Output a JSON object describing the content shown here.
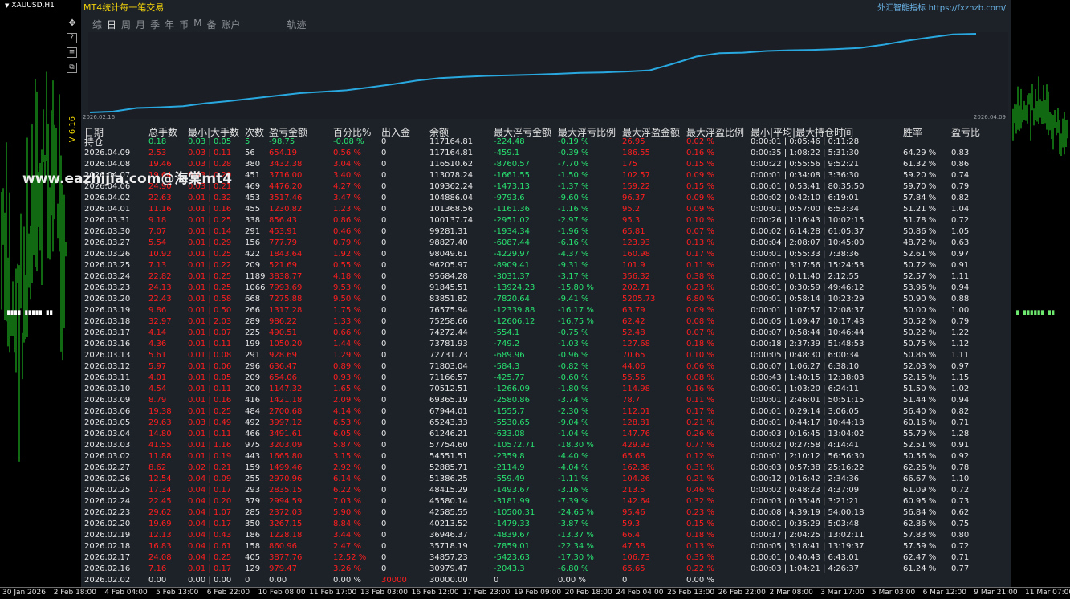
{
  "symbol": "XAUUSD,H1",
  "indicator_label": "V 6.16",
  "dots_left": "∎∎∎∎ ∎∎∎∎∎ ∎∎",
  "dots_right": "∎ ∎∎∎∎∎∎ ∎∎",
  "panel": {
    "title": "MT4统计每一笔交易",
    "brand": "外汇智能指标",
    "url": "https://fxznzb.com/",
    "tabs": [
      "综",
      "日",
      "周",
      "月",
      "季",
      "年",
      "币",
      "M",
      "备",
      "账户",
      "轨迹"
    ],
    "active_tab": "日",
    "equity_start_date": "2026.02.16",
    "equity_end_date": "2026.04.09",
    "equity_color": "#29a8e0",
    "headers": [
      "日期",
      "总手数",
      "最小|大手数",
      "次数",
      "盈亏金额",
      "百分比%",
      "出入金",
      "余额",
      "最大浮亏金额",
      "最大浮亏比例",
      "最大浮盈金额",
      "最大浮盈比例",
      "最小|平均|最大持仓时间",
      "胜率",
      "盈亏比"
    ],
    "holding_row": [
      "持仓",
      "0.18",
      "0.03 | 0.05",
      "5",
      "-98.75",
      "-0.08 %",
      "0",
      "117164.81",
      "-224.48",
      "-0.19 %",
      "26.95",
      "0.02 %",
      "0:00:01 | 0:05:46 | 0:11:28",
      "",
      ""
    ],
    "rows": [
      [
        "2026.04.09",
        "2.53",
        "0.03 | 0.11",
        "56",
        "654.19",
        "0.56 %",
        "0",
        "117164.81",
        "-459.1",
        "-0.39 %",
        "186.55",
        "0.16 %",
        "0:00:35 | 1:08:22 | 5:31:30",
        "64.29 %",
        "0.83"
      ],
      [
        "2026.04.08",
        "19.46",
        "0.03 | 0.28",
        "380",
        "3432.38",
        "3.04 %",
        "0",
        "116510.62",
        "-8760.57",
        "-7.70 %",
        "175",
        "0.15 %",
        "0:00:22 | 0:55:56 | 9:52:21",
        "61.32 %",
        "0.86"
      ],
      [
        "2026.04.07",
        "19.64",
        "0.03 | 0.20",
        "451",
        "3716.00",
        "3.40 %",
        "0",
        "113078.24",
        "-1661.55",
        "-1.50 %",
        "102.57",
        "0.09 %",
        "0:00:01 | 0:34:08 | 3:36:30",
        "59.20 %",
        "0.74"
      ],
      [
        "2026.04.06",
        "24.90",
        "0.03 | 0.21",
        "469",
        "4476.20",
        "4.27 %",
        "0",
        "109362.24",
        "-1473.13",
        "-1.37 %",
        "159.22",
        "0.15 %",
        "0:00:01 | 0:53:41 | 80:35:50",
        "59.70 %",
        "0.79"
      ],
      [
        "2026.04.02",
        "22.63",
        "0.01 | 0.32",
        "453",
        "3517.46",
        "3.47 %",
        "0",
        "104886.04",
        "-9793.6",
        "-9.60 %",
        "96.37",
        "0.09 %",
        "0:00:02 | 0:42:10 | 6:19:01",
        "57.84 %",
        "0.82"
      ],
      [
        "2026.04.01",
        "11.16",
        "0.01 | 0.16",
        "455",
        "1230.82",
        "1.23 %",
        "0",
        "101368.56",
        "-1161.36",
        "-1.16 %",
        "95.2",
        "0.09 %",
        "0:00:01 | 0:57:00 | 6:53:34",
        "51.21 %",
        "1.04"
      ],
      [
        "2026.03.31",
        "9.18",
        "0.01 | 0.25",
        "338",
        "856.43",
        "0.86 %",
        "0",
        "100137.74",
        "-2951.02",
        "-2.97 %",
        "95.3",
        "0.10 %",
        "0:00:26 | 1:16:43 | 10:02:15",
        "51.78 %",
        "0.72"
      ],
      [
        "2026.03.30",
        "7.07",
        "0.01 | 0.14",
        "291",
        "453.91",
        "0.46 %",
        "0",
        "99281.31",
        "-1934.34",
        "-1.96 %",
        "65.81",
        "0.07 %",
        "0:00:02 | 6:14:28 | 61:05:37",
        "50.86 %",
        "1.05"
      ],
      [
        "2026.03.27",
        "5.54",
        "0.01 | 0.29",
        "156",
        "777.79",
        "0.79 %",
        "0",
        "98827.40",
        "-6087.44",
        "-6.16 %",
        "123.93",
        "0.13 %",
        "0:00:04 | 2:08:07 | 10:45:00",
        "48.72 %",
        "0.63"
      ],
      [
        "2026.03.26",
        "10.92",
        "0.01 | 0.25",
        "422",
        "1843.64",
        "1.92 %",
        "0",
        "98049.61",
        "-4229.97",
        "-4.37 %",
        "160.98",
        "0.17 %",
        "0:00:01 | 0:55:33 | 7:38:36",
        "52.61 %",
        "0.97"
      ],
      [
        "2026.03.25",
        "7.13",
        "0.01 | 0.22",
        "209",
        "521.69",
        "0.55 %",
        "0",
        "96205.97",
        "-8909.41",
        "-9.31 %",
        "101.9",
        "0.11 %",
        "0:00:01 | 3:17:56 | 15:24:53",
        "50.72 %",
        "0.91"
      ],
      [
        "2026.03.24",
        "22.82",
        "0.01 | 0.25",
        "1189",
        "3838.77",
        "4.18 %",
        "0",
        "95684.28",
        "-3031.37",
        "-3.17 %",
        "356.32",
        "0.38 %",
        "0:00:01 | 0:11:40 | 2:12:55",
        "52.57 %",
        "1.11"
      ],
      [
        "2026.03.23",
        "24.13",
        "0.01 | 0.25",
        "1066",
        "7993.69",
        "9.53 %",
        "0",
        "91845.51",
        "-13924.23",
        "-15.80 %",
        "202.71",
        "0.23 %",
        "0:00:01 | 0:30:59 | 49:46:12",
        "53.96 %",
        "0.94"
      ],
      [
        "2026.03.20",
        "22.43",
        "0.01 | 0.58",
        "668",
        "7275.88",
        "9.50 %",
        "0",
        "83851.82",
        "-7820.64",
        "-9.41 %",
        "5205.73",
        "6.80 %",
        "0:00:01 | 0:58:14 | 10:23:29",
        "50.90 %",
        "0.88"
      ],
      [
        "2026.03.19",
        "9.86",
        "0.01 | 0.50",
        "266",
        "1317.28",
        "1.75 %",
        "0",
        "76575.94",
        "-12339.88",
        "-16.17 %",
        "63.79",
        "0.09 %",
        "0:00:01 | 1:07:57 | 12:08:37",
        "50.00 %",
        "1.00"
      ],
      [
        "2026.03.18",
        "32.97",
        "0.01 | 2.03",
        "289",
        "986.22",
        "1.33 %",
        "0",
        "75258.66",
        "-12606.12",
        "-16.75 %",
        "62.42",
        "0.08 %",
        "0:00:05 | 1:09:47 | 10:17:48",
        "50.52 %",
        "0.79"
      ],
      [
        "2026.03.17",
        "4.14",
        "0.01 | 0.07",
        "225",
        "490.51",
        "0.66 %",
        "0",
        "74272.44",
        "-554.1",
        "-0.75 %",
        "52.48",
        "0.07 %",
        "0:00:07 | 0:58:44 | 10:46:44",
        "50.22 %",
        "1.22"
      ],
      [
        "2026.03.16",
        "4.36",
        "0.01 | 0.11",
        "199",
        "1050.20",
        "1.44 %",
        "0",
        "73781.93",
        "-749.2",
        "-1.03 %",
        "127.68",
        "0.18 %",
        "0:00:18 | 2:37:39 | 51:48:53",
        "50.75 %",
        "1.12"
      ],
      [
        "2026.03.13",
        "5.61",
        "0.01 | 0.08",
        "291",
        "928.69",
        "1.29 %",
        "0",
        "72731.73",
        "-689.96",
        "-0.96 %",
        "70.65",
        "0.10 %",
        "0:00:05 | 0:48:30 | 6:00:34",
        "50.86 %",
        "1.11"
      ],
      [
        "2026.03.12",
        "5.97",
        "0.01 | 0.06",
        "296",
        "636.47",
        "0.89 %",
        "0",
        "71803.04",
        "-584.3",
        "-0.82 %",
        "44.06",
        "0.06 %",
        "0:00:07 | 1:06:27 | 6:38:10",
        "52.03 %",
        "0.97"
      ],
      [
        "2026.03.11",
        "4.01",
        "0.01 | 0.05",
        "209",
        "654.06",
        "0.93 %",
        "0",
        "71166.57",
        "-425.77",
        "-0.60 %",
        "55.56",
        "0.08 %",
        "0:00:43 | 1:40:15 | 12:38:03",
        "52.15 %",
        "1.15"
      ],
      [
        "2026.03.10",
        "4.54",
        "0.01 | 0.11",
        "200",
        "1147.32",
        "1.65 %",
        "0",
        "70512.51",
        "-1266.09",
        "-1.80 %",
        "114.98",
        "0.16 %",
        "0:00:01 | 1:03:20 | 6:24:11",
        "51.50 %",
        "1.02"
      ],
      [
        "2026.03.09",
        "8.79",
        "0.01 | 0.16",
        "416",
        "1421.18",
        "2.09 %",
        "0",
        "69365.19",
        "-2580.86",
        "-3.74 %",
        "78.7",
        "0.11 %",
        "0:00:01 | 2:46:01 | 50:51:15",
        "51.44 %",
        "0.94"
      ],
      [
        "2026.03.06",
        "19.38",
        "0.01 | 0.25",
        "484",
        "2700.68",
        "4.14 %",
        "0",
        "67944.01",
        "-1555.7",
        "-2.30 %",
        "112.01",
        "0.17 %",
        "0:00:01 | 0:29:14 | 3:06:05",
        "56.40 %",
        "0.82"
      ],
      [
        "2026.03.05",
        "29.63",
        "0.03 | 0.49",
        "492",
        "3997.12",
        "6.53 %",
        "0",
        "65243.33",
        "-5530.65",
        "-9.04 %",
        "128.81",
        "0.21 %",
        "0:00:01 | 0:44:17 | 10:44:18",
        "60.16 %",
        "0.71"
      ],
      [
        "2026.03.04",
        "14.80",
        "0.01 | 0.11",
        "466",
        "3491.61",
        "6.05 %",
        "0",
        "61246.21",
        "-633.08",
        "-1.04 %",
        "147.76",
        "0.26 %",
        "0:00:03 | 0:16:45 | 13:04:02",
        "55.79 %",
        "1.28"
      ],
      [
        "2026.03.03",
        "41.55",
        "0.01 | 1.16",
        "975",
        "3203.09",
        "5.87 %",
        "0",
        "57754.60",
        "-10572.71",
        "-18.30 %",
        "429.93",
        "0.77 %",
        "0:00:02 | 0:27:58 | 4:14:41",
        "52.51 %",
        "0.91"
      ],
      [
        "2026.03.02",
        "11.88",
        "0.01 | 0.19",
        "443",
        "1665.80",
        "3.15 %",
        "0",
        "54551.51",
        "-2359.8",
        "-4.40 %",
        "65.68",
        "0.12 %",
        "0:00:01 | 2:10:12 | 56:56:30",
        "50.56 %",
        "0.92"
      ],
      [
        "2026.02.27",
        "8.62",
        "0.02 | 0.21",
        "159",
        "1499.46",
        "2.92 %",
        "0",
        "52885.71",
        "-2114.9",
        "-4.04 %",
        "162.38",
        "0.31 %",
        "0:00:03 | 0:57:38 | 25:16:22",
        "62.26 %",
        "0.78"
      ],
      [
        "2026.02.26",
        "12.54",
        "0.04 | 0.09",
        "255",
        "2970.96",
        "6.14 %",
        "0",
        "51386.25",
        "-559.49",
        "-1.11 %",
        "104.26",
        "0.21 %",
        "0:00:12 | 0:16:42 | 2:34:36",
        "66.67 %",
        "1.10"
      ],
      [
        "2026.02.25",
        "17.34",
        "0.04 | 0.17",
        "293",
        "2835.15",
        "6.22 %",
        "0",
        "48415.29",
        "-1493.67",
        "-3.16 %",
        "213.5",
        "0.46 %",
        "0:00:02 | 0:48:23 | 4:37:09",
        "61.09 %",
        "0.72"
      ],
      [
        "2026.02.24",
        "22.45",
        "0.04 | 0.20",
        "379",
        "2994.59",
        "7.03 %",
        "0",
        "45580.14",
        "-3181.99",
        "-7.39 %",
        "142.64",
        "0.32 %",
        "0:00:03 | 0:35:46 | 3:21:21",
        "60.95 %",
        "0.73"
      ],
      [
        "2026.02.23",
        "29.62",
        "0.04 | 1.07",
        "285",
        "2372.03",
        "5.90 %",
        "0",
        "42585.55",
        "-10500.31",
        "-24.65 %",
        "95.46",
        "0.23 %",
        "0:00:08 | 4:39:19 | 54:00:18",
        "56.84 %",
        "0.62"
      ],
      [
        "2026.02.20",
        "19.69",
        "0.04 | 0.17",
        "350",
        "3267.15",
        "8.84 %",
        "0",
        "40213.52",
        "-1479.33",
        "-3.87 %",
        "59.3",
        "0.15 %",
        "0:00:01 | 0:35:29 | 5:03:48",
        "62.86 %",
        "0.75"
      ],
      [
        "2026.02.19",
        "12.13",
        "0.04 | 0.43",
        "186",
        "1228.18",
        "3.44 %",
        "0",
        "36946.37",
        "-4839.67",
        "-13.37 %",
        "66.4",
        "0.18 %",
        "0:00:17 | 2:04:25 | 13:02:11",
        "57.83 %",
        "0.80"
      ],
      [
        "2026.02.18",
        "16.83",
        "0.04 | 0.61",
        "158",
        "860.96",
        "2.47 %",
        "0",
        "35718.19",
        "-7859.01",
        "-22.34 %",
        "47.58",
        "0.13 %",
        "0:00:05 | 3:18:41 | 13:19:37",
        "57.59 %",
        "0.72"
      ],
      [
        "2026.02.17",
        "24.08",
        "0.04 | 0.25",
        "405",
        "3877.76",
        "12.52 %",
        "0",
        "34857.23",
        "-5423.63",
        "-17.30 %",
        "106.73",
        "0.35 %",
        "0:00:01 | 0:40:43 | 6:43:01",
        "62.47 %",
        "0.71"
      ],
      [
        "2026.02.16",
        "7.16",
        "0.01 | 0.17",
        "129",
        "979.47",
        "3.26 %",
        "0",
        "30979.47",
        "-2043.3",
        "-6.80 %",
        "65.65",
        "0.22 %",
        "0:00:03 | 1:04:21 | 4:26:37",
        "61.24 %",
        "0.77"
      ],
      [
        "2026.02.02",
        "0.00",
        "0.00 | 0.00",
        "0",
        "0.00",
        "0.00 %",
        "30000",
        "30000.00",
        "0",
        "0.00 %",
        "0",
        "0.00 %",
        "",
        "",
        ""
      ]
    ]
  },
  "watermark": "www.eazhijia.com@海棠mt4",
  "time_axis": [
    "30 Jan 2026",
    "2 Feb 18:00",
    "4 Feb 04:00",
    "5 Feb 13:00",
    "6 Feb 22:00",
    "10 Feb 08:00",
    "11 Feb 17:00",
    "13 Feb 03:00",
    "16 Feb 12:00",
    "17 Feb 23:00",
    "19 Feb 09:00",
    "20 Feb 18:00",
    "24 Feb 04:00",
    "25 Feb 13:00",
    "26 Feb 22:00",
    "2 Mar 08:00",
    "3 Mar 17:00",
    "5 Mar 03:00",
    "6 Mar 12:00",
    "9 Mar 21:00",
    "11 Mar 07:00"
  ]
}
